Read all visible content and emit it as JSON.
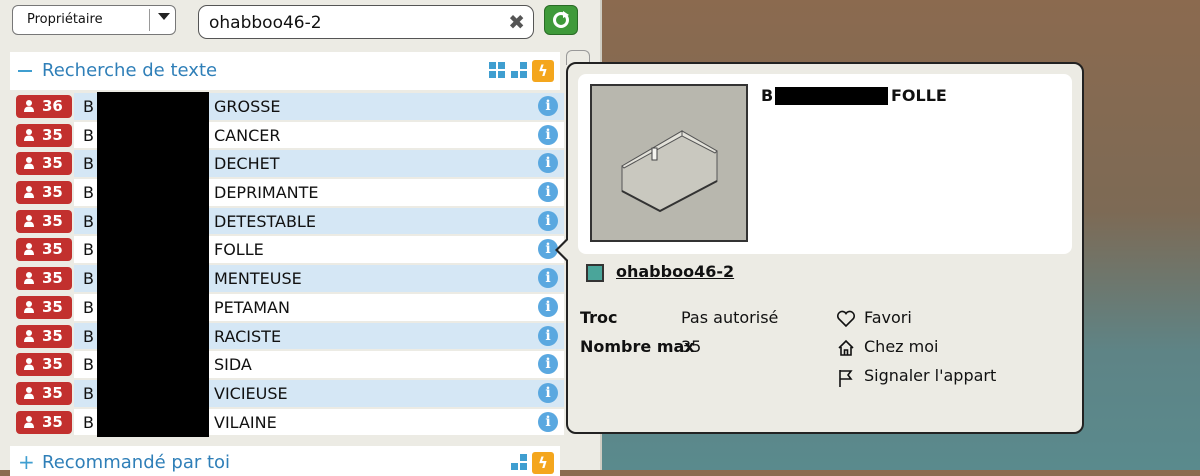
{
  "toolbar": {
    "owner_filter": "Propriétaire",
    "search_value": "ohabboo46-2"
  },
  "section_text_search": {
    "title": "Recherche de texte"
  },
  "rooms": [
    {
      "users": "36",
      "prefix": "B",
      "name": "GROSSE"
    },
    {
      "users": "35",
      "prefix": "B",
      "name": "CANCER"
    },
    {
      "users": "35",
      "prefix": "B",
      "name": "DECHET"
    },
    {
      "users": "35",
      "prefix": "B",
      "name": "DEPRIMANTE"
    },
    {
      "users": "35",
      "prefix": "B",
      "name": "DETESTABLE"
    },
    {
      "users": "35",
      "prefix": "B",
      "name": "FOLLE"
    },
    {
      "users": "35",
      "prefix": "B",
      "name": "MENTEUSE"
    },
    {
      "users": "35",
      "prefix": "B",
      "name": "PETAMAN"
    },
    {
      "users": "35",
      "prefix": "B",
      "name": "RACISTE"
    },
    {
      "users": "35",
      "prefix": "B",
      "name": "SIDA"
    },
    {
      "users": "35",
      "prefix": "B",
      "name": "VICIEUSE"
    },
    {
      "users": "35",
      "prefix": "B",
      "name": "VILAINE"
    }
  ],
  "section_recommended": {
    "title": "Recommandé par toi"
  },
  "popup": {
    "title_prefix": "B",
    "title_suffix": "FOLLE",
    "owner": "ohabboo46-2",
    "trade_label": "Troc",
    "trade_value": "Pas autorisé",
    "max_label": "Nombre max",
    "max_value": "35",
    "favorite_label": "Favori",
    "home_label": "Chez moi",
    "report_label": "Signaler l'appart"
  },
  "colors": {
    "badge": "#c2302e",
    "accent_blue": "#2f7fb8",
    "row_alt": "#d5e7f5",
    "refresh_green": "#3f9a3a",
    "bolt_orange": "#f4a61d"
  },
  "icons": [
    "user-icon",
    "info-icon",
    "clear-icon",
    "refresh-icon",
    "bolt-icon",
    "grid-icon",
    "heart-icon",
    "home-icon",
    "flag-icon"
  ]
}
